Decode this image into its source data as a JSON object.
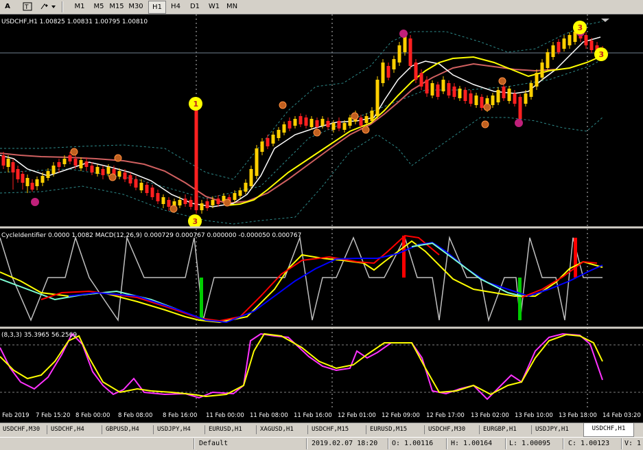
{
  "toolbar": {
    "letter_a": "A",
    "timeframes": [
      "M1",
      "M5",
      "M15",
      "M30",
      "H1",
      "H4",
      "D1",
      "W1",
      "MN"
    ],
    "active_timeframe": "H1"
  },
  "chart": {
    "symbol_header": "USDCHF,H1  1.00825 1.00831 1.00795 1.00810",
    "indicator_header": "CycleIdentifier 0.0000 1.0082  MACD(12,26,9) 0.000729 0.000767 0.000000 -0.000050 0.000767",
    "stoch_header": "(8,3,3) 35.3965 56.2569",
    "marker_labels": [
      "1",
      "3",
      "3",
      "3"
    ],
    "time_labels": [
      "6 Feb 2019",
      "7 Feb 15:20",
      "8 Feb 00:00",
      "8 Feb 08:00",
      "8 Feb 16:00",
      "11 Feb 00:00",
      "11 Feb 08:00",
      "11 Feb 16:00",
      "12 Feb 01:00",
      "12 Feb 09:00",
      "12 Feb 17:00",
      "13 Feb 02:00",
      "13 Feb 10:00",
      "13 Feb 18:00",
      "14 Feb 03:20"
    ],
    "colors": {
      "background": "#000000",
      "bull_candle": "#ffd000",
      "bear_candle": "#ff2020",
      "fast_ma": "#ffffff",
      "slow_ma": "#ffff00",
      "long_ma": "#d06060",
      "bands": "#2e8b8b",
      "macd_line": "#ff0000",
      "macd_signal": "#0000ff",
      "macd_main": "#ffff00",
      "macd_aux": "#7fffd4",
      "cycle_line": "#c0c0c0",
      "stoch_main": "#ff33ff",
      "stoch_signal": "#ffff00"
    }
  },
  "tabs": [
    "USDCHF,M30",
    "USDCHF,H4",
    "GBPUSD,H4",
    "USDJPY,H4",
    "EURUSD,H1",
    "XAGUSD,H1",
    "USDCHF,M15",
    "EURUSD,M15",
    "USDCHF,M30",
    "EURGBP,H1",
    "USDJPY,H1",
    "USDCHF,H1"
  ],
  "active_tab": "USDCHF,H1",
  "status": {
    "profile": "Default",
    "datetime": "2019.02.07 18:20",
    "open": "O: 1.00116",
    "high": "H: 1.00164",
    "low": "L: 1.00095",
    "close": "C: 1.00123",
    "volume": "V: 1"
  }
}
